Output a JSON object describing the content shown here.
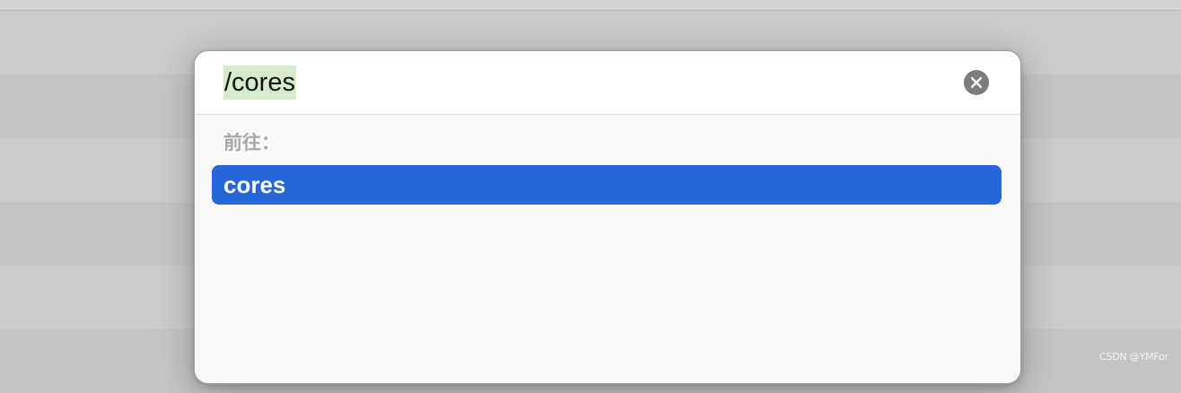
{
  "go_to_folder": {
    "path_input": {
      "value": "/cores",
      "clear_icon": "close-circle-icon"
    },
    "section_label": "前往：",
    "results": [
      {
        "label": "cores",
        "selected": true
      }
    ]
  },
  "watermark": "CSDN @YMFor",
  "colors": {
    "selection_highlight": "#d5ebc9",
    "result_selected": "#2766d9",
    "clear_button": "#7c7c7c"
  }
}
